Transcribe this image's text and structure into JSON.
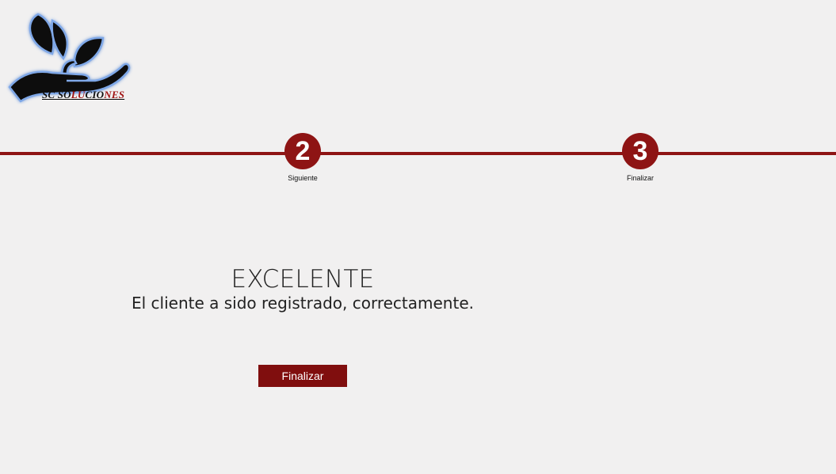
{
  "brand": {
    "logo_text_dark_1": "SC SO",
    "logo_text_red_1": "LU",
    "logo_text_dark_2": "CIO",
    "logo_text_red_2": "NES",
    "accent_color": "#8e1414"
  },
  "steps": [
    {
      "number": "2",
      "label": "Siguiente"
    },
    {
      "number": "3",
      "label": "Finalizar"
    }
  ],
  "message": {
    "title": "EXCELENTE",
    "subtitle": "El cliente a sido registrado, correctamente."
  },
  "actions": {
    "finish_label": "Finalizar"
  }
}
